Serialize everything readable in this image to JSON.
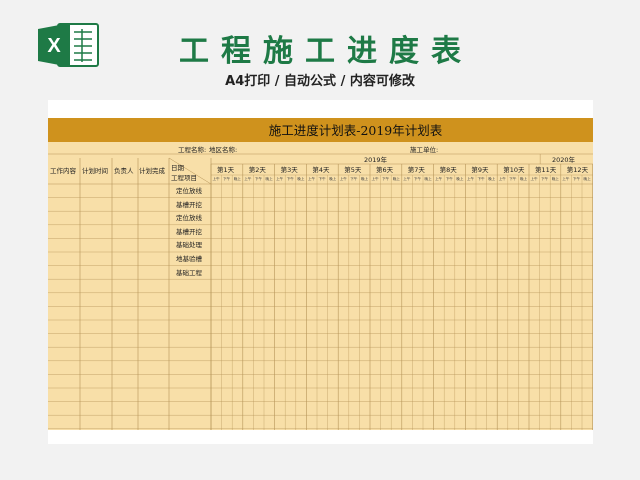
{
  "header": {
    "title": "工程施工进度表",
    "subtitle": "A4打印 / 自动公式 / 内容可修改"
  },
  "logo": {
    "icon": "excel-icon",
    "letter": "X",
    "color": "#1e7a46"
  },
  "colors": {
    "banner": "#cf921d",
    "sheet_fill": "#f8dfa8",
    "grid": "#b69458",
    "title_green": "#1e7a46"
  },
  "sheet": {
    "title": "施工进度计划表-2019年计划表",
    "project_name_label": "工程名称:",
    "region_label": "地区名称:",
    "company_label": "施工单位:",
    "columns": {
      "work": "工作内容",
      "plan_time": "计划时间",
      "owner": "负责人",
      "plan_done": "计划完成",
      "diag_date": "日期",
      "diag_item": "工程项目"
    },
    "years": [
      "2019年",
      "2020年"
    ],
    "weeks": [
      "第1天",
      "第2天",
      "第3天",
      "第4天",
      "第5天",
      "第6天",
      "第7天",
      "第8天",
      "第9天",
      "第10天",
      "第11天",
      "第12天"
    ],
    "subcols": [
      "上午",
      "下午",
      "晚上"
    ],
    "items": [
      "定位放线",
      "基槽开挖",
      "定位放线",
      "基槽开挖",
      "基础处理",
      "地基验槽",
      "基础工程"
    ]
  }
}
